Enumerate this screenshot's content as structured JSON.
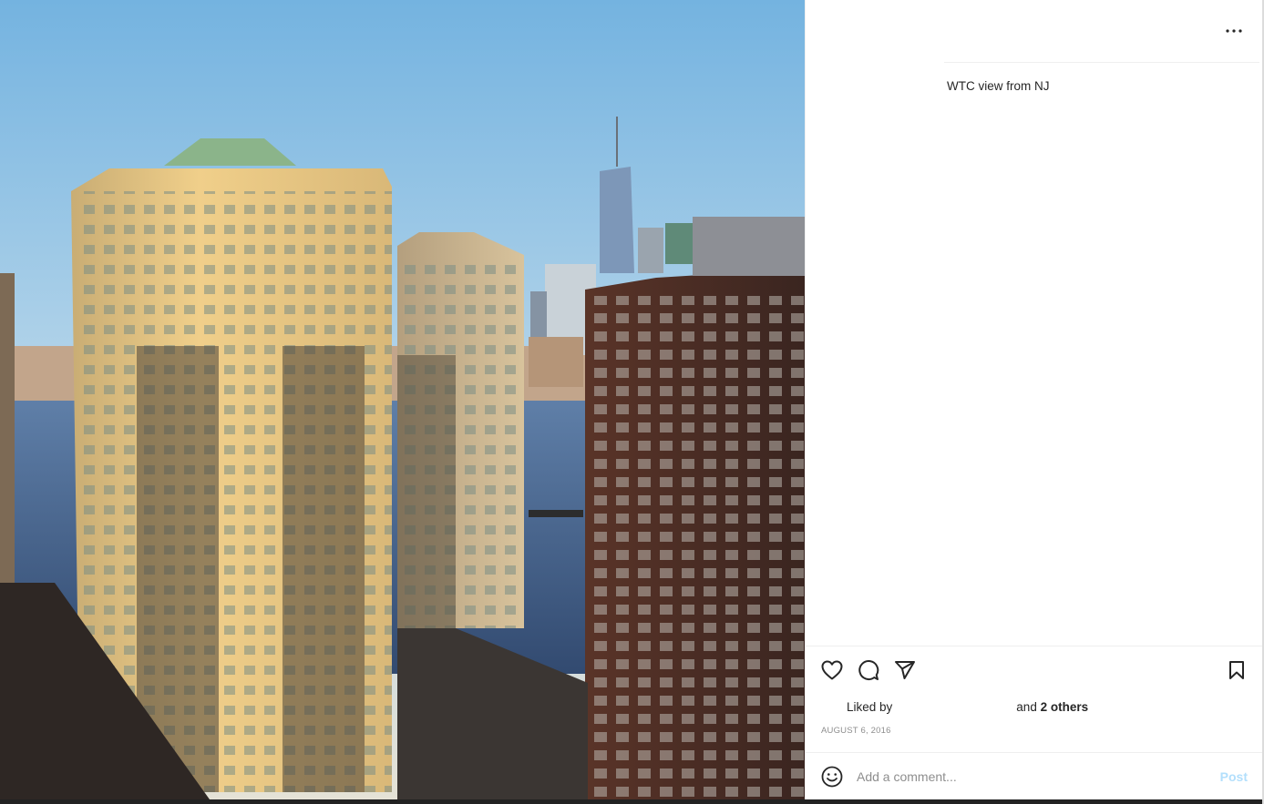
{
  "post": {
    "caption": "WTC view from NJ",
    "likes_prefix": "Liked by",
    "likes_middle": "and",
    "likes_others": "2 others",
    "date": "AUGUST 6, 2016"
  },
  "comment": {
    "placeholder": "Add a comment...",
    "post_label": "Post"
  },
  "icons": {
    "more": "more-options-icon",
    "like": "heart-icon",
    "comment": "comment-icon",
    "share": "share-icon",
    "save": "bookmark-icon",
    "emoji": "emoji-icon"
  },
  "colors": {
    "post_button": "#b2dffc",
    "text": "#262626",
    "muted": "#8e8e8e"
  }
}
